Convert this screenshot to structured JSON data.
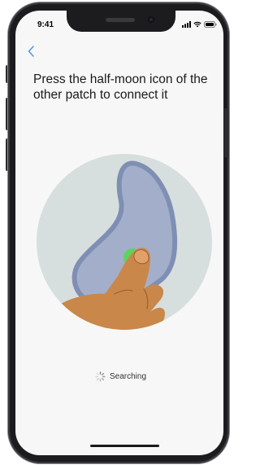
{
  "status_bar": {
    "time": "9:41",
    "icons": [
      "signal-icon",
      "wifi-icon",
      "battery-icon"
    ]
  },
  "nav": {
    "back_icon": "chevron-left-icon"
  },
  "main": {
    "title": "Press the half-moon icon of the other patch to connect it",
    "illustration_icon": "finger-pressing-patch-illustration"
  },
  "status": {
    "label": "Searching",
    "icon": "spinner-icon"
  },
  "colors": {
    "accent": "#4a90e2",
    "circle_bg": "#d7dede",
    "patch_fill": "#a3afca",
    "patch_stroke": "#7f8fb4",
    "indicator_green": "#5fd35f",
    "skin": "#c9874a"
  }
}
